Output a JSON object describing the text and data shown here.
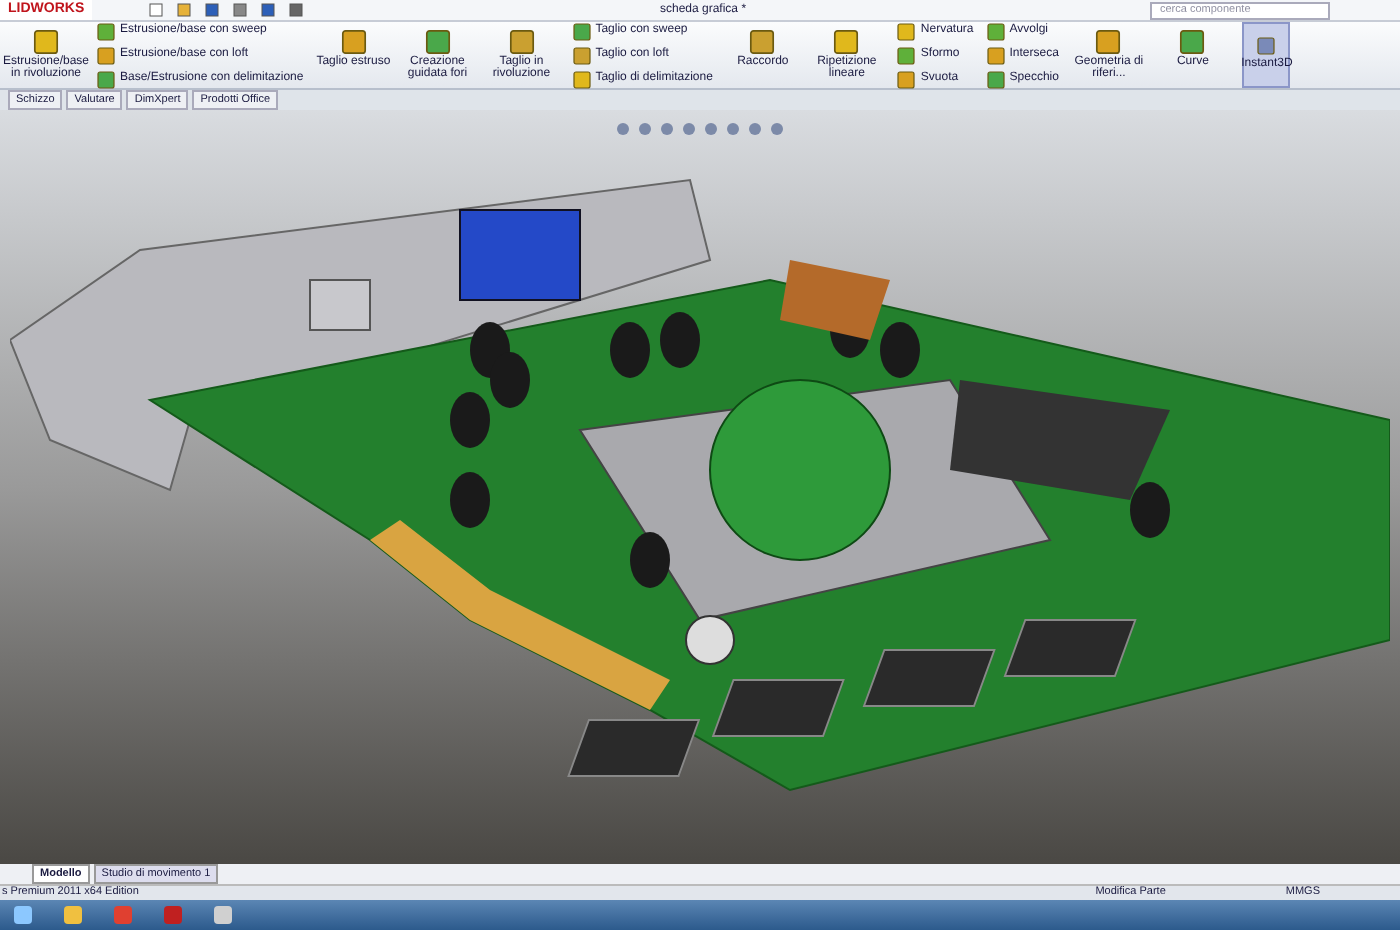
{
  "window": {
    "logo": "LIDWORKS",
    "title": "scheda grafica *",
    "search": {
      "placeholder": "cerca componente"
    }
  },
  "ribbon": {
    "groups": [
      {
        "kind": "large",
        "items": [
          {
            "label": "Estrusione/base in rivoluzione"
          }
        ]
      },
      {
        "kind": "small",
        "items": [
          {
            "label": "Estrusione/base con sweep"
          },
          {
            "label": "Estrusione/base con loft"
          },
          {
            "label": "Base/Estrusione con delimitazione"
          }
        ]
      },
      {
        "kind": "large",
        "items": [
          {
            "label": "Taglio estruso"
          },
          {
            "label": "Creazione guidata fori"
          },
          {
            "label": "Taglio in rivoluzione"
          }
        ]
      },
      {
        "kind": "small",
        "items": [
          {
            "label": "Taglio con sweep"
          },
          {
            "label": "Taglio con loft"
          },
          {
            "label": "Taglio di delimitazione"
          }
        ]
      },
      {
        "kind": "large",
        "items": [
          {
            "label": "Raccordo"
          },
          {
            "label": "Ripetizione lineare"
          }
        ]
      },
      {
        "kind": "small",
        "items": [
          {
            "label": "Nervatura"
          },
          {
            "label": "Sformo"
          },
          {
            "label": "Svuota"
          }
        ]
      },
      {
        "kind": "small",
        "items": [
          {
            "label": "Avvolgi"
          },
          {
            "label": "Interseca"
          },
          {
            "label": "Specchio"
          }
        ]
      },
      {
        "kind": "large",
        "items": [
          {
            "label": "Geometria di riferi..."
          },
          {
            "label": "Curve"
          }
        ]
      },
      {
        "kind": "toggle",
        "items": [
          {
            "label": "Instant3D",
            "selected": true
          }
        ]
      }
    ]
  },
  "tabs": [
    {
      "label": "Schizzo",
      "selected": false
    },
    {
      "label": "Valutare",
      "selected": false
    },
    {
      "label": "DimXpert",
      "selected": false
    },
    {
      "label": "Prodotti Office",
      "selected": false
    }
  ],
  "bottom_tabs": [
    {
      "label": "Modello",
      "selected": true
    },
    {
      "label": "Studio di movimento 1",
      "selected": false
    }
  ],
  "status_bar": {
    "edition": "s Premium 2011 x64 Edition",
    "mode": "Modifica Parte",
    "units": "MMGS"
  }
}
